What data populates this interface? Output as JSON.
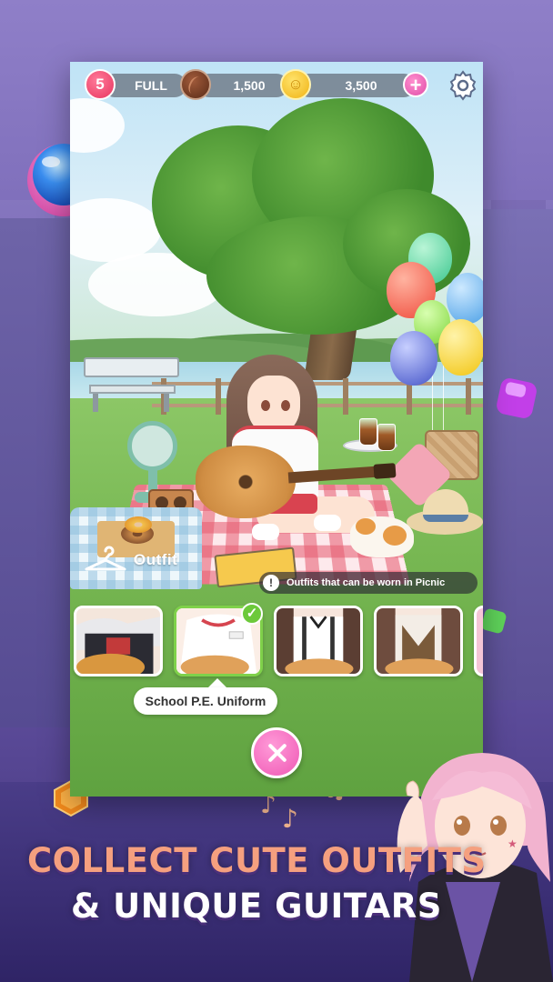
{
  "status_bar": {
    "lives": "5",
    "lives_status": "FULL",
    "chocolate": "1,500",
    "coins": "3,500",
    "add_label": "+"
  },
  "outfit_panel": {
    "title": "Outfit",
    "hint": "Outfits that can be worn in Picnic",
    "hint_icon": "!",
    "selected_outfit": "School P.E. Uniform",
    "check_mark": "✓"
  },
  "promo": {
    "headline_line1": "COLLECT CUTE OUTFITS",
    "headline_line2": "& UNIQUE GUITARS"
  },
  "colors": {
    "accent_pink": "#ef58b4",
    "selected_green": "#7fd14a",
    "headline_orange": "#f5a07f"
  }
}
